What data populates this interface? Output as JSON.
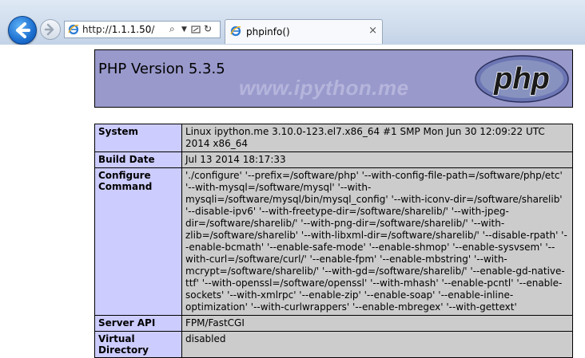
{
  "browser": {
    "address": "http://1.1.1.50/",
    "address_prefix": "http://",
    "address_host": "1.1.1.50",
    "address_suffix": "/",
    "tab_title": "phpinfo()",
    "tab_close": "×"
  },
  "header": {
    "version": "PHP Version 5.3.5",
    "watermark": "www.ipython.me",
    "logo_text": "php"
  },
  "rows": [
    {
      "label": "System",
      "value": "Linux ipython.me 3.10.0-123.el7.x86_64 #1 SMP Mon Jun 30 12:09:22 UTC 2014 x86_64"
    },
    {
      "label": "Build Date",
      "value": "Jul 13 2014 18:17:33"
    },
    {
      "label": "Configure Command",
      "value": "'./configure' '--prefix=/software/php' '--with-config-file-path=/software/php/etc' '--with-mysql=/software/mysql' '--with-mysqli=/software/mysql/bin/mysql_config' '--with-iconv-dir=/software/sharelib' '--disable-ipv6' '--with-freetype-dir=/software/sharelib/' '--with-jpeg-dir=/software/sharelib/' '--with-png-dir=/software/sharelib/' '--with-zlib=/software/sharelib' '--with-libxml-dir=/software/sharelib/' '--disable-rpath' '--enable-bcmath' '--enable-safe-mode' '--enable-shmop' '--enable-sysvsem' '--with-curl=/software/curl/' '--enable-fpm' '--enable-mbstring' '--with-mcrypt=/software/sharelib/' '--with-gd=/software/sharelib/' '--enable-gd-native-ttf' '--with-openssl=/software/openssl' '--with-mhash' '--enable-pcntl' '--enable-sockets' '--with-xmlrpc' '--enable-zip' '--enable-soap' '--enable-inline-optimization' '--with-curlwrappers' '--enable-mbregex' '--with-gettext'"
    },
    {
      "label": "Server API",
      "value": "FPM/FastCGI"
    },
    {
      "label": "Virtual Directory",
      "value": "disabled"
    }
  ]
}
